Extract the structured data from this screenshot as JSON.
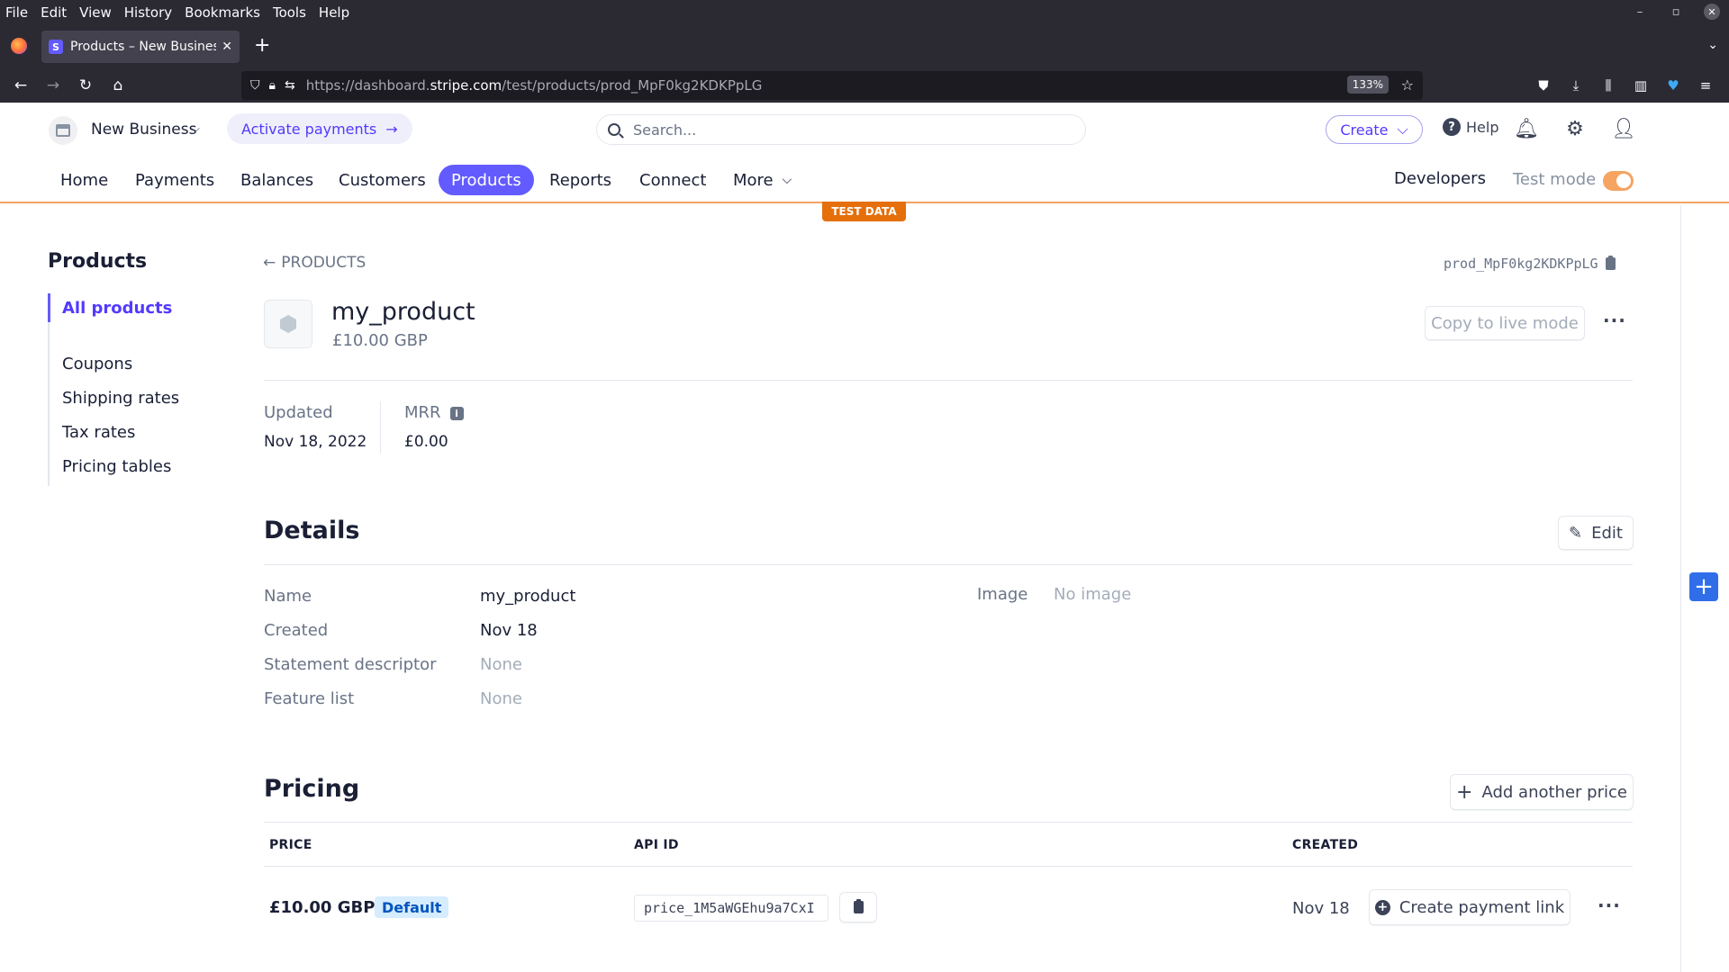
{
  "os_menu": [
    "File",
    "Edit",
    "View",
    "History",
    "Bookmarks",
    "Tools",
    "Help"
  ],
  "tab": {
    "title": "Products – New Business",
    "favicon": "S"
  },
  "urlbar": {
    "url_prefix": "https://dashboard.",
    "url_domain": "stripe.com",
    "url_path": "/test/products/prod_MpF0kg2KDKPpLG",
    "zoom": "133%"
  },
  "header": {
    "account_name": "New Business",
    "activate_label": "Activate payments",
    "search_placeholder": "Search...",
    "create_label": "Create",
    "help_label": "Help"
  },
  "nav": {
    "items": [
      "Home",
      "Payments",
      "Balances",
      "Customers",
      "Products",
      "Reports",
      "Connect",
      "More"
    ],
    "active": "Products",
    "developers": "Developers",
    "test_mode_label": "Test mode",
    "test_mode_on": true,
    "test_data_badge": "TEST DATA"
  },
  "sidebar": {
    "title": "Products",
    "items": [
      "All products",
      "Coupons",
      "Shipping rates",
      "Tax rates",
      "Pricing tables"
    ],
    "active": "All products"
  },
  "product": {
    "back_label": "PRODUCTS",
    "id": "prod_MpF0kg2KDKPpLG",
    "name": "my_product",
    "price": "£10.00 GBP",
    "copy_live_label": "Copy to live mode",
    "updated_label": "Updated",
    "updated_value": "Nov 18, 2022",
    "mrr_label": "MRR",
    "mrr_value": "£0.00"
  },
  "details": {
    "title": "Details",
    "edit_label": "Edit",
    "rows": [
      {
        "label": "Name",
        "value": "my_product"
      },
      {
        "label": "Created",
        "value": "Nov 18"
      },
      {
        "label": "Statement descriptor",
        "value": "None"
      },
      {
        "label": "Feature list",
        "value": "None"
      }
    ],
    "image_label": "Image",
    "image_value": "No image"
  },
  "pricing": {
    "title": "Pricing",
    "add_label": "Add another price",
    "columns": [
      "PRICE",
      "API ID",
      "CREATED"
    ],
    "rows": [
      {
        "price": "£10.00 GBP",
        "badge": "Default",
        "api_id": "price_1M5aWGEhu9a7CxI",
        "created": "Nov 18",
        "action": "Create payment link"
      }
    ]
  },
  "colors": {
    "accent": "#635bff",
    "test_mode": "#e56f0b",
    "badge_bg": "#d6ecff"
  }
}
